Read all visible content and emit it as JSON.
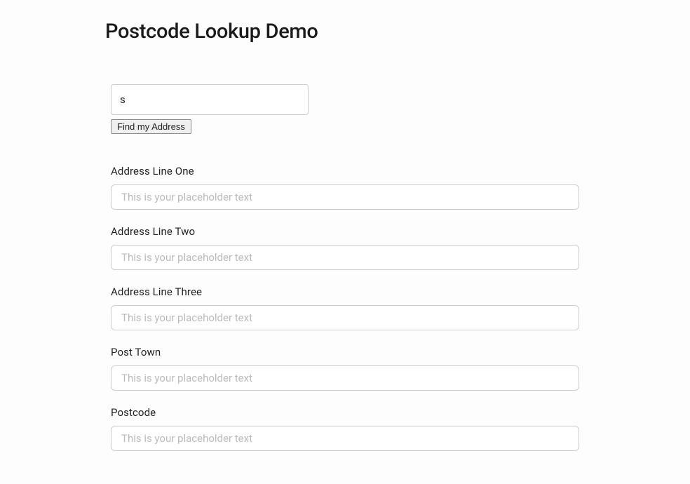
{
  "page": {
    "title": "Postcode Lookup Demo"
  },
  "lookup": {
    "search_value": "s",
    "find_button_label": "Find my Address"
  },
  "fields": {
    "line1": {
      "label": "Address Line One",
      "placeholder": "This is your placeholder text",
      "value": ""
    },
    "line2": {
      "label": "Address Line Two",
      "placeholder": "This is your placeholder text",
      "value": ""
    },
    "line3": {
      "label": "Address Line Three",
      "placeholder": "This is your placeholder text",
      "value": ""
    },
    "post_town": {
      "label": "Post Town",
      "placeholder": "This is your placeholder text",
      "value": ""
    },
    "postcode": {
      "label": "Postcode",
      "placeholder": "This is your placeholder text",
      "value": ""
    }
  }
}
